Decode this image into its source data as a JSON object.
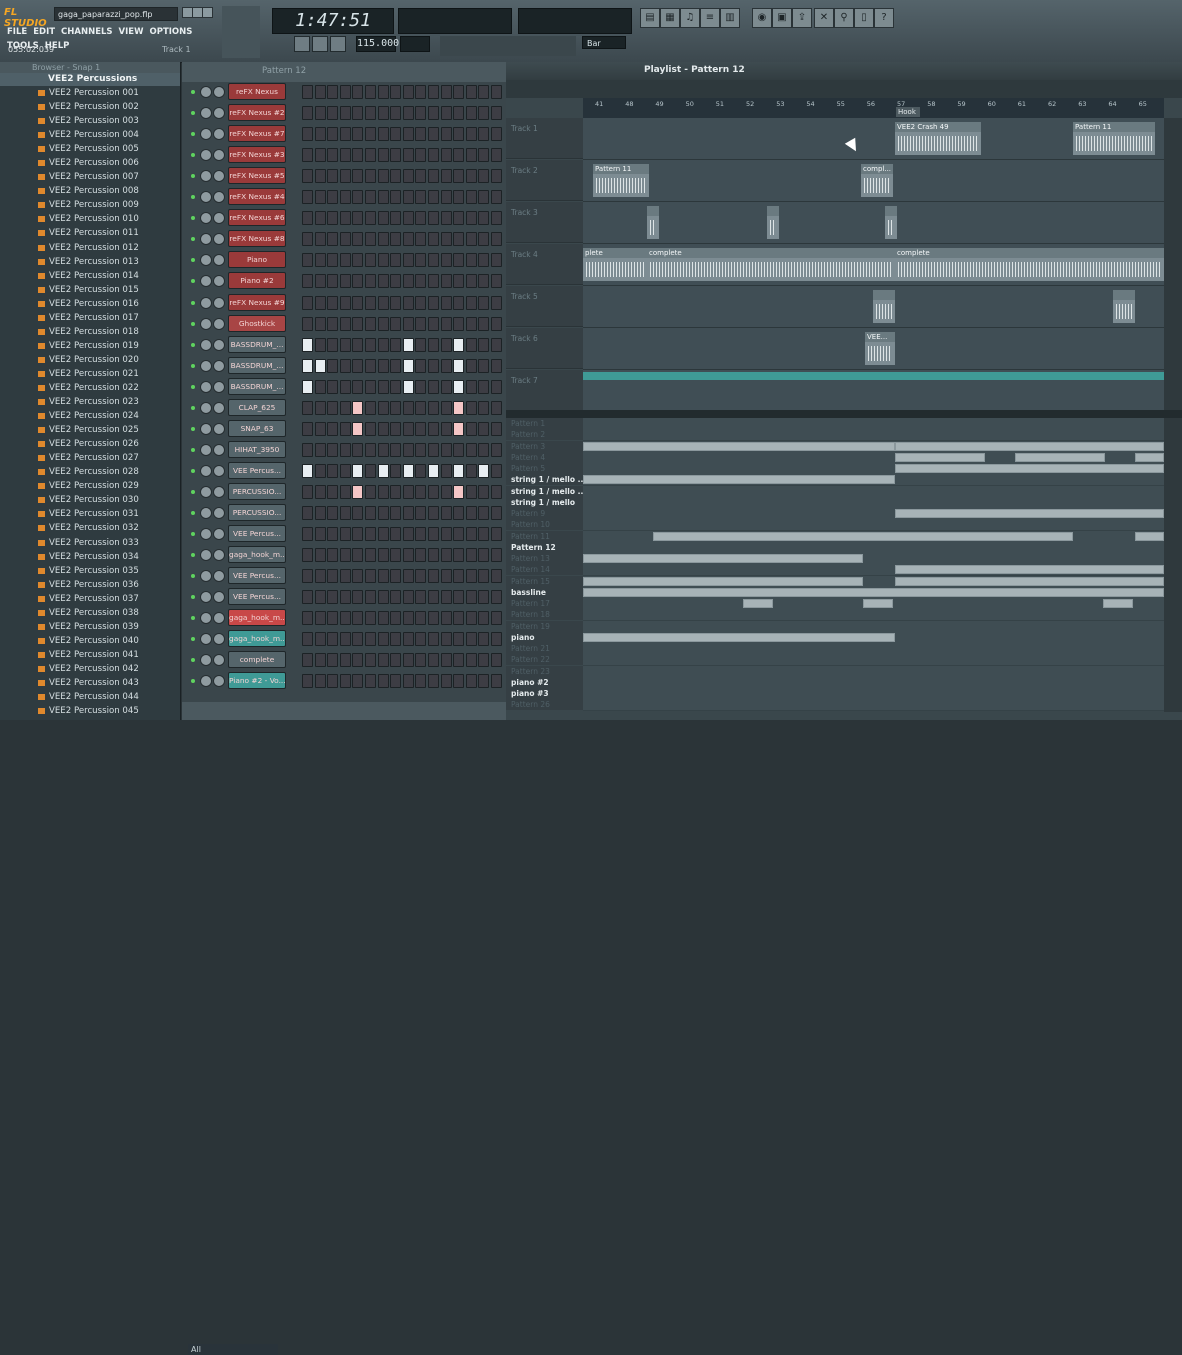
{
  "app": {
    "logo": "FL STUDIO",
    "filename": "gaga_paparazzi_pop.flp",
    "hint": "055:02:039",
    "hint_right": "Track 1"
  },
  "menu": [
    "FILE",
    "EDIT",
    "CHANNELS",
    "VIEW",
    "OPTIONS",
    "TOOLS",
    "HELP"
  ],
  "transport": {
    "time": "1:47:51",
    "tempo": "115.000",
    "snap": "Bar"
  },
  "browser": {
    "title": "Browser - Snap 1",
    "folder": "VEE2 Percussions",
    "items": [
      "VEE2 Percussion 001",
      "VEE2 Percussion 002",
      "VEE2 Percussion 003",
      "VEE2 Percussion 004",
      "VEE2 Percussion 005",
      "VEE2 Percussion 006",
      "VEE2 Percussion 007",
      "VEE2 Percussion 008",
      "VEE2 Percussion 009",
      "VEE2 Percussion 010",
      "VEE2 Percussion 011",
      "VEE2 Percussion 012",
      "VEE2 Percussion 013",
      "VEE2 Percussion 014",
      "VEE2 Percussion 015",
      "VEE2 Percussion 016",
      "VEE2 Percussion 017",
      "VEE2 Percussion 018",
      "VEE2 Percussion 019",
      "VEE2 Percussion 020",
      "VEE2 Percussion 021",
      "VEE2 Percussion 022",
      "VEE2 Percussion 023",
      "VEE2 Percussion 024",
      "VEE2 Percussion 025",
      "VEE2 Percussion 026",
      "VEE2 Percussion 027",
      "VEE2 Percussion 028",
      "VEE2 Percussion 029",
      "VEE2 Percussion 030",
      "VEE2 Percussion 031",
      "VEE2 Percussion 032",
      "VEE2 Percussion 033",
      "VEE2 Percussion 034",
      "VEE2 Percussion 035",
      "VEE2 Percussion 036",
      "VEE2 Percussion 037",
      "VEE2 Percussion 038",
      "VEE2 Percussion 039",
      "VEE2 Percussion 040",
      "VEE2 Percussion 041",
      "VEE2 Percussion 042",
      "VEE2 Percussion 043",
      "VEE2 Percussion 044",
      "VEE2 Percussion 045"
    ]
  },
  "rack": {
    "title": "Pattern 12",
    "filter": "All",
    "channels": [
      {
        "name": "reFX Nexus",
        "color": "#9a3a3a"
      },
      {
        "name": "reFX Nexus #2",
        "color": "#9a3a3a"
      },
      {
        "name": "reFX Nexus #7",
        "color": "#9a3a3a"
      },
      {
        "name": "reFX Nexus #3",
        "color": "#9a3a3a"
      },
      {
        "name": "reFX Nexus #5",
        "color": "#9a3a3a"
      },
      {
        "name": "reFX Nexus #4",
        "color": "#9a3a3a"
      },
      {
        "name": "reFX Nexus #6",
        "color": "#9a3a3a"
      },
      {
        "name": "reFX Nexus #8",
        "color": "#9a3a3a"
      },
      {
        "name": "Piano",
        "color": "#9a3a3a"
      },
      {
        "name": "Piano #2",
        "color": "#9a3a3a"
      },
      {
        "name": "reFX Nexus #9",
        "color": "#9a3a3a"
      },
      {
        "name": "Ghostkick",
        "color": "#a84545"
      },
      {
        "name": "BASSDRUM_...",
        "color": "#55656b"
      },
      {
        "name": "BASSDRUM_...",
        "color": "#55656b"
      },
      {
        "name": "BASSDRUM_...",
        "color": "#55656b"
      },
      {
        "name": "CLAP_625",
        "color": "#55656b"
      },
      {
        "name": "SNAP_63",
        "color": "#55656b"
      },
      {
        "name": "HIHAT_3950",
        "color": "#55656b"
      },
      {
        "name": "VEE Percus...",
        "color": "#55656b"
      },
      {
        "name": "PERCUSSIO...",
        "color": "#55656b"
      },
      {
        "name": "PERCUSSIO...",
        "color": "#55656b"
      },
      {
        "name": "VEE Percus...",
        "color": "#55656b"
      },
      {
        "name": "gaga_hook_m...",
        "color": "#55656b"
      },
      {
        "name": "VEE Percus...",
        "color": "#55656b"
      },
      {
        "name": "VEE Percus...",
        "color": "#55656b"
      },
      {
        "name": "gaga_hook_m...",
        "color": "#c84848"
      },
      {
        "name": "gaga_hook_m...",
        "color": "#3f9a96"
      },
      {
        "name": "complete",
        "color": "#55656b"
      },
      {
        "name": "Piano #2 - Vo...",
        "color": "#3f9a96"
      }
    ]
  },
  "playlist": {
    "title": "Playlist - Pattern 12",
    "marker": "Hook",
    "bars": [
      "41",
      "48",
      "49",
      "50",
      "51",
      "52",
      "53",
      "54",
      "55",
      "56",
      "57",
      "58",
      "59",
      "60",
      "61",
      "62",
      "63",
      "64",
      "65"
    ],
    "tracks": [
      "Track 1",
      "Track 2",
      "Track 3",
      "Track 4",
      "Track 5",
      "Track 6",
      "Track 7"
    ],
    "clips": {
      "t1a": "VEE2 Crash 49",
      "t1b": "Pattern 11",
      "t2a": "Pattern 11",
      "t2b": "compl...",
      "t4a": "plete",
      "t4b": "complete",
      "t4c": "complete",
      "t6a": "VEE..."
    },
    "patterns": [
      "Pattern 1",
      "Pattern 2",
      "Pattern 3",
      "Pattern 4",
      "Pattern 5",
      "string 1 / mello ...",
      "string 1 / mello ...",
      "string 1 / mello",
      "Pattern 9",
      "Pattern 10",
      "Pattern 11",
      "Pattern 12",
      "Pattern 13",
      "Pattern 14",
      "Pattern 15",
      "bassline",
      "Pattern 17",
      "Pattern 18",
      "Pattern 19",
      "piano",
      "Pattern 21",
      "Pattern 22",
      "Pattern 23",
      "piano #2",
      "piano #3",
      "Pattern 26"
    ]
  }
}
